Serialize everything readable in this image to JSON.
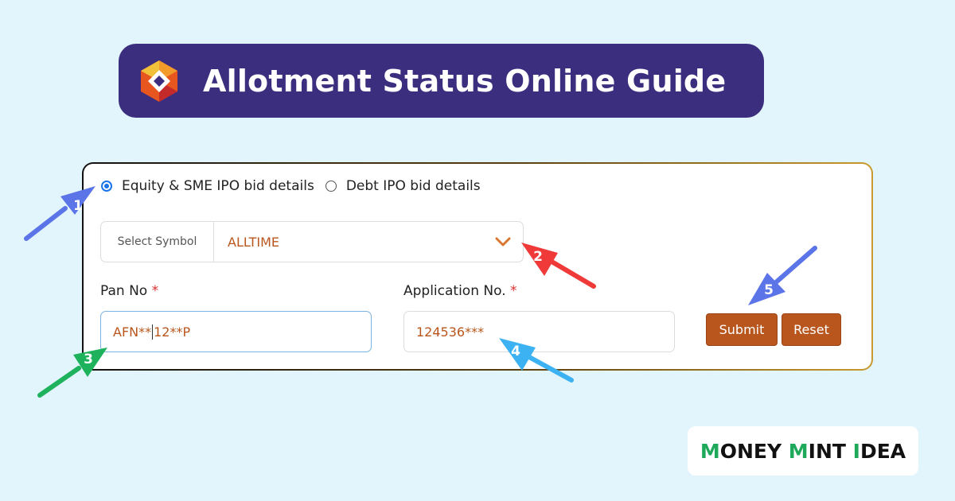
{
  "banner": {
    "title": "Allotment Status Online Guide"
  },
  "form": {
    "radio_options": [
      {
        "label": "Equity & SME IPO bid details",
        "selected": true
      },
      {
        "label": "Debt IPO bid details",
        "selected": false
      }
    ],
    "symbol": {
      "prefix": "Select Symbol",
      "value": "ALLTIME"
    },
    "pan": {
      "label": "Pan No",
      "required_mark": "*",
      "value_a": "AFN**",
      "value_b": "12**P"
    },
    "application": {
      "label": "Application No.",
      "required_mark": "*",
      "value": "124536***"
    },
    "submit_label": "Submit",
    "reset_label": "Reset"
  },
  "markers": [
    {
      "number": "1",
      "color": "#5b74e8"
    },
    {
      "number": "2",
      "color": "#f03a3a"
    },
    {
      "number": "3",
      "color": "#1fb25c"
    },
    {
      "number": "4",
      "color": "#3db2f2"
    },
    {
      "number": "5",
      "color": "#5b74e8"
    }
  ],
  "brand": {
    "part1": "M",
    "part2": "ONEY ",
    "part3": "M",
    "part4": "INT ",
    "part5": "I",
    "part6": "DEA"
  },
  "colors": {
    "banner_bg": "#3b2e7e",
    "accent": "#b8561d",
    "page_bg": "#e2f4fc"
  }
}
